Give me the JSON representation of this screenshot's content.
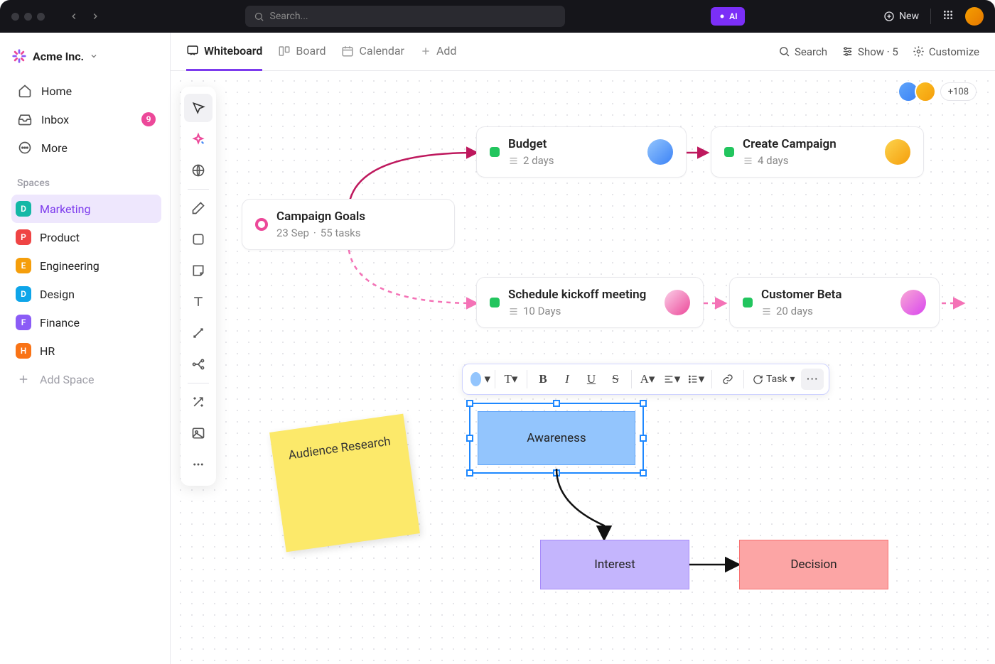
{
  "titlebar": {
    "search_placeholder": "Search...",
    "ai_label": "AI",
    "new_label": "New"
  },
  "workspace": {
    "name": "Acme Inc."
  },
  "nav": {
    "home": "Home",
    "inbox": "Inbox",
    "inbox_count": "9",
    "more": "More"
  },
  "spaces_header": "Spaces",
  "spaces": [
    {
      "letter": "D",
      "label": "Marketing",
      "color": "#14b8a6",
      "active": true
    },
    {
      "letter": "P",
      "label": "Product",
      "color": "#ef4444"
    },
    {
      "letter": "E",
      "label": "Engineering",
      "color": "#f59e0b"
    },
    {
      "letter": "D",
      "label": "Design",
      "color": "#0ea5e9"
    },
    {
      "letter": "F",
      "label": "Finance",
      "color": "#8b5cf6"
    },
    {
      "letter": "H",
      "label": "HR",
      "color": "#f97316"
    }
  ],
  "add_space": "Add Space",
  "tabs": {
    "whiteboard": "Whiteboard",
    "board": "Board",
    "calendar": "Calendar",
    "add": "Add"
  },
  "tabactions": {
    "search": "Search",
    "show": "Show · 5",
    "customize": "Customize"
  },
  "avatars_more": "+108",
  "cards": {
    "goals": {
      "title": "Campaign Goals",
      "date": "23 Sep",
      "tasks": "55 tasks"
    },
    "budget": {
      "title": "Budget",
      "meta": "2 days"
    },
    "create": {
      "title": "Create Campaign",
      "meta": "4 days"
    },
    "kickoff": {
      "title": "Schedule kickoff meeting",
      "meta": "10 Days"
    },
    "beta": {
      "title": "Customer Beta",
      "meta": "20 days"
    }
  },
  "sticky": {
    "text": "Audience Research"
  },
  "shapes": {
    "awareness": "Awareness",
    "interest": "Interest",
    "decision": "Decision"
  },
  "fmt": {
    "task": "Task"
  }
}
